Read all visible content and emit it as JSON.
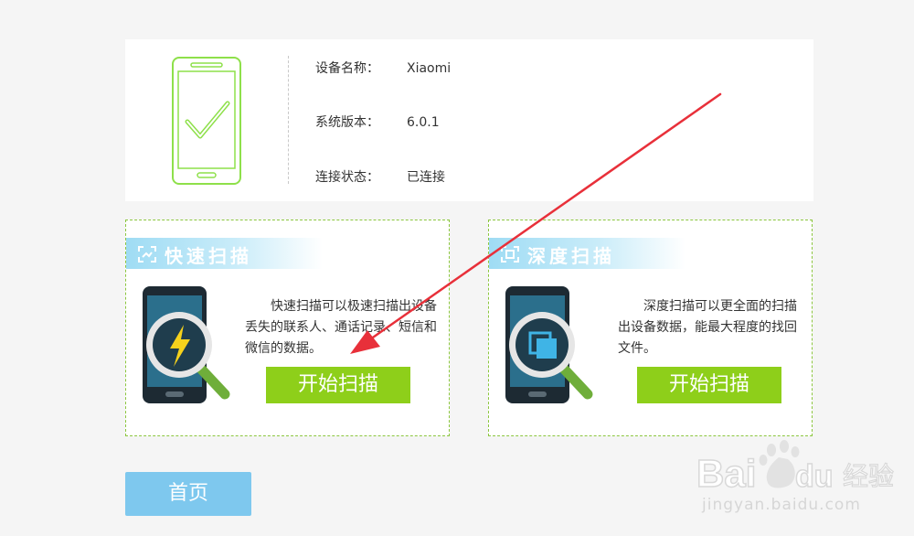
{
  "device": {
    "icon": "phone-check-icon",
    "name_label": "设备名称：",
    "name_value": "Xiaomi",
    "version_label": "系统版本：",
    "version_value": "6.0.1",
    "status_label": "连接状态：",
    "status_value": "已连接"
  },
  "quick_scan": {
    "title": "快速扫描",
    "description": "快速扫描可以极速扫描出设备丢失的联系人、通话记录、短信和微信的数据。",
    "button_label": "开始扫描",
    "icon": "lightning-magnifier-icon"
  },
  "deep_scan": {
    "title": "深度扫描",
    "description": "深度扫描可以更全面的扫描出设备数据，能最大程度的找回文件。",
    "button_label": "开始扫描",
    "icon": "layers-magnifier-icon"
  },
  "home_button": {
    "label": "首页"
  },
  "watermark": {
    "logo_text": "Baidu经验",
    "url": "jingyan.baidu.com"
  },
  "colors": {
    "accent_green": "#8ecf1a",
    "outline_green": "#8cc63f",
    "light_blue": "#7ec8ee",
    "annotation_red": "#e8303a"
  }
}
